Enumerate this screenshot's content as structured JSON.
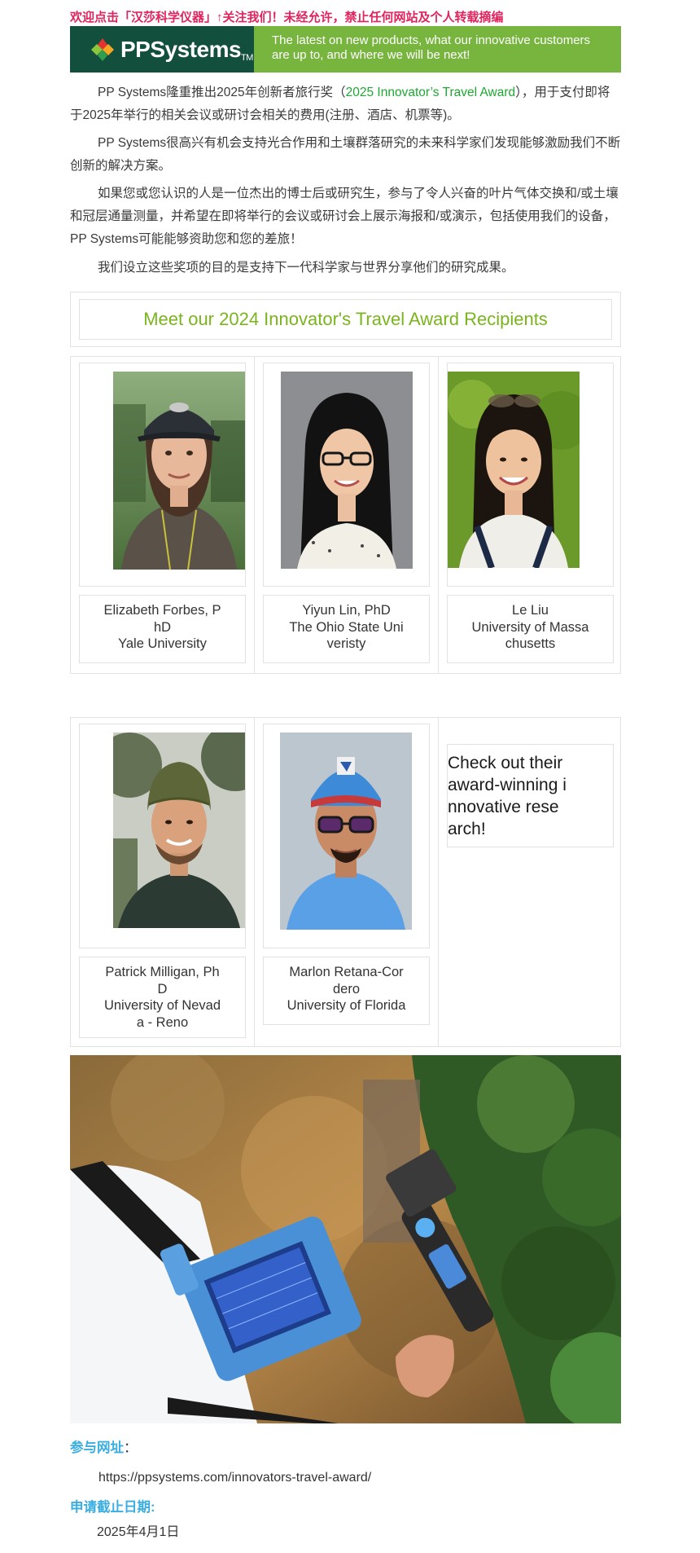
{
  "top_notice": "欢迎点击「汉莎科学仪器」↑关注我们！未经允许，禁止任何网站及个人转载摘编",
  "banner": {
    "logo": "PPSystems",
    "logo_tm": "TM",
    "tagline_line1": "The latest on new products, what our innovative customers",
    "tagline_line2": "are up to, and where we will be next!"
  },
  "paragraphs": {
    "p1_prefix": "PP Systems隆重推出2025年创新者旅行奖（",
    "p1_highlight": "2025 Innovator’s Travel Award",
    "p1_suffix": "），用于支付即将于2025年举行的相关会议或研讨会相关的费用(注册、酒店、机票等)。",
    "p2": "PP Systems很高兴有机会支持光合作用和土壤群落研究的未来科学家们发现能够激励我们不断创新的解决方案。",
    "p3": "如果您或您认识的人是一位杰出的博士后或研究生，参与了令人兴奋的叶片气体交换和/或土壤和冠层通量测量，并希望在即将举行的会议或研讨会上展示海报和/或演示，包括使用我们的设备，PP Systems可能能够资助您和您的差旅！",
    "p4": "我们设立这些奖项的目的是支持下一代科学家与世界分享他们的研究成果。"
  },
  "recipients_title": "Meet our 2024 Innovator's Travel Award Recipients",
  "recipients": [
    {
      "line1": "Elizabeth Forbes, P",
      "line2": "hD",
      "line3": "Yale University",
      "line4": ""
    },
    {
      "line1": "Yiyun Lin, PhD",
      "line2": "The Ohio State Uni",
      "line3": "veristy",
      "line4": ""
    },
    {
      "line1": "Le Liu",
      "line2": "University of Massa",
      "line3": "chusetts",
      "line4": ""
    },
    {
      "line1": "Patrick Milligan, Ph",
      "line2": "D",
      "line3": "University of Nevad",
      "line4": "a - Reno"
    },
    {
      "line1": "Marlon Retana-Cor",
      "line2": "dero",
      "line3": "University of Florida",
      "line4": ""
    }
  ],
  "cta_text": "Check out their\naward-winning i\nnnovative rese\narch!",
  "footer": {
    "url_label": "参与网址",
    "url_colon": "：",
    "url_value": "https://ppsystems.com/innovators-travel-award/",
    "deadline_label": "申请截止日期:",
    "deadline_value": "2025年4月1日"
  },
  "colors": {
    "notice_red": "#e0245e",
    "banner_dark_green": "#134f3d",
    "banner_light_green": "#77b53e",
    "title_green": "#7ab51d",
    "highlight_green": "#1ea832",
    "label_blue": "#3aaee0"
  },
  "icons": {
    "logo_mark": "leaf-diamond-logo-icon"
  }
}
